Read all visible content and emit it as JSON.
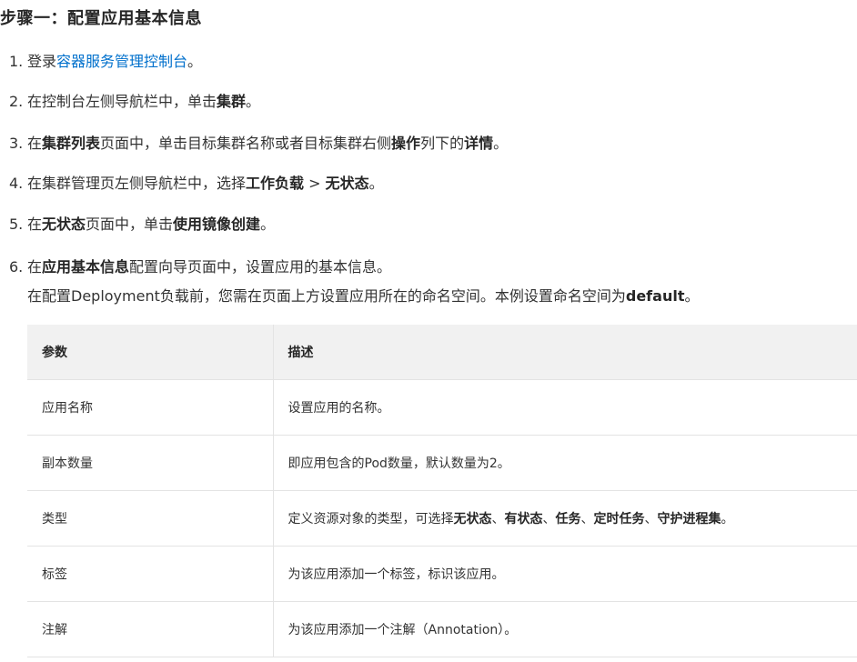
{
  "title": "步骤一：配置应用基本信息",
  "steps": [
    {
      "num": "1.",
      "t0": "登录",
      "link": "容器服务管理控制台",
      "t1": "。"
    },
    {
      "num": "2.",
      "t0": "在控制台左侧导航栏中，单击",
      "b0": "集群",
      "t1": "。"
    },
    {
      "num": "3.",
      "t0": "在",
      "b0": "集群列表",
      "t1": "页面中，单击目标集群名称或者目标集群右侧",
      "b1": "操作",
      "t2": "列下的",
      "b2": "详情",
      "t3": "。"
    },
    {
      "num": "4.",
      "t0": "在集群管理页左侧导航栏中，选择",
      "b0": "工作负载",
      "t1": " > ",
      "b1": "无状态",
      "t2": "。"
    },
    {
      "num": "5.",
      "t0": "在",
      "b0": "无状态",
      "t1": "页面中，单击",
      "b1": "使用镜像创建",
      "t2": "。"
    },
    {
      "num": "6.",
      "t0": "在",
      "b0": "应用基本信息",
      "t1": "配置向导页面中，设置应用的基本信息。"
    }
  ],
  "note": {
    "t0": "在配置Deployment负载前，您需在页面上方设置应用所在的命名空间。本例设置命名空间为",
    "b0": "default",
    "t1": "。"
  },
  "table": {
    "headers": [
      "参数",
      "描述"
    ],
    "rows": [
      {
        "param": "应用名称",
        "desc": "设置应用的名称。"
      },
      {
        "param": "副本数量",
        "desc": "即应用包含的Pod数量，默认数量为2。"
      },
      {
        "param": "类型",
        "d0": "定义资源对象的类型，可选择",
        "b0": "无状态",
        "s0": "、",
        "b1": "有状态",
        "s1": "、",
        "b2": "任务",
        "s2": "、",
        "b3": "定时任务",
        "s3": "、",
        "b4": "守护进程集",
        "s4": "。"
      },
      {
        "param": "标签",
        "desc": "为该应用添加一个标签，标识该应用。"
      },
      {
        "param": "注解",
        "desc": "为该应用添加一个注解（Annotation）。"
      }
    ]
  }
}
